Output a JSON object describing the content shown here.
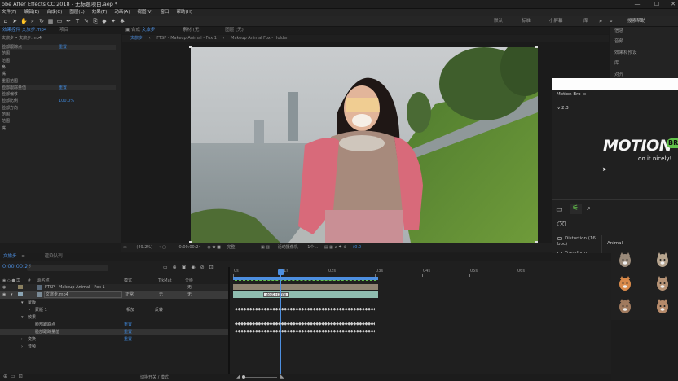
{
  "window": {
    "title": "obe After Effects CC 2018 - 无标题项目.aep *",
    "minimize": "—",
    "maximize": "☐",
    "close": "✕"
  },
  "menu": [
    "文件(F)",
    "编辑(E)",
    "合成(C)",
    "图层(L)",
    "效果(T)",
    "动画(A)",
    "视图(V)",
    "窗口",
    "帮助(H)"
  ],
  "workspaces": [
    "默认",
    "标准",
    "小屏幕",
    "库"
  ],
  "search_placeholder": "搜索帮助",
  "effects_panel": {
    "tab": "效果控件 文旅步.mp4",
    "tab2": "项目",
    "layer_path": "文旅步 • 文旅步.mp4",
    "rows": [
      {
        "label": "脸部跟踪点",
        "value": "重置"
      },
      {
        "label": "范围",
        "value": ""
      },
      {
        "label": "范围",
        "value": ""
      },
      {
        "label": "鼻",
        "value": ""
      },
      {
        "label": "嘴",
        "value": ""
      },
      {
        "label": "重图范围",
        "value": ""
      },
      {
        "label": "脸部跟踪量值",
        "value": "重置"
      },
      {
        "label": "脸部偏移",
        "value": ""
      },
      {
        "label": "脸部比例",
        "value": "100.0%"
      },
      {
        "label": "脸部方向",
        "value": ""
      },
      {
        "label": "范围",
        "value": ""
      },
      {
        "label": "范围",
        "value": ""
      },
      {
        "label": "嘴",
        "value": ""
      }
    ]
  },
  "comp_panel": {
    "tab_prefix": "合成",
    "tab": "文旅步",
    "layer_tab": "图层 (无)",
    "footage_tab": "素材 (无)",
    "breadcrumbs": [
      "文旅步",
      "FTSP - Makeup Animal - Fox 1",
      "Makeup Animal Fox - Holder"
    ],
    "footer": {
      "zoom": "(49.2%)",
      "timecode": "0:00:00:24",
      "resolution": "完整",
      "camera": "活动摄像机",
      "views": "1个...",
      "exposure": "+0.0"
    }
  },
  "right_panel": {
    "items": [
      "信息",
      "音频",
      "效果和预设",
      "库",
      "对齐"
    ]
  },
  "motion_bro": {
    "title": "Motion Bro",
    "version": "v 2.3",
    "logo": "MOTION",
    "logo_tag": "BR",
    "tagline": "do it nicely!",
    "categories": [
      "Distortion (16 bpc)",
      "Transform",
      "Makeup",
      "Animal",
      "Beauty",
      "Clown",
      "Mud",
      "Other"
    ],
    "selected_category": "Animal",
    "grid_title": "Animal"
  },
  "timeline": {
    "tab": "文旅步",
    "tab2": "渲染队列",
    "timecode": "0:00:00:24",
    "headers": {
      "name": "源名称",
      "mode": "模式",
      "trkmat": "TrkMat",
      "parent": "父级"
    },
    "layers": [
      {
        "num": "1",
        "name": "FTSP - Makeup Animal - Fox 1",
        "mode": "",
        "parent": "无"
      },
      {
        "num": "2",
        "name": "文旅步.mp4",
        "mode": "正常",
        "trkmat": "无",
        "parent": "无"
      }
    ],
    "sub_rows": [
      {
        "label": "蒙版",
        "value": ""
      },
      {
        "label": "蒙版 1",
        "value": "相加",
        "extra": "反转"
      },
      {
        "label": "效果",
        "value": ""
      },
      {
        "label": "脸部跟踪点",
        "value": "重置"
      },
      {
        "label": "脸部跟踪量值",
        "value": "重置"
      },
      {
        "label": "变换",
        "value": "重置"
      },
      {
        "label": "音频",
        "value": ""
      }
    ],
    "ruler": [
      "0s",
      "01s",
      "02s",
      "03s",
      "04s",
      "05s",
      "06s"
    ],
    "marker": "Best Frame",
    "footer_toggle": "切换开关 / 模式"
  }
}
